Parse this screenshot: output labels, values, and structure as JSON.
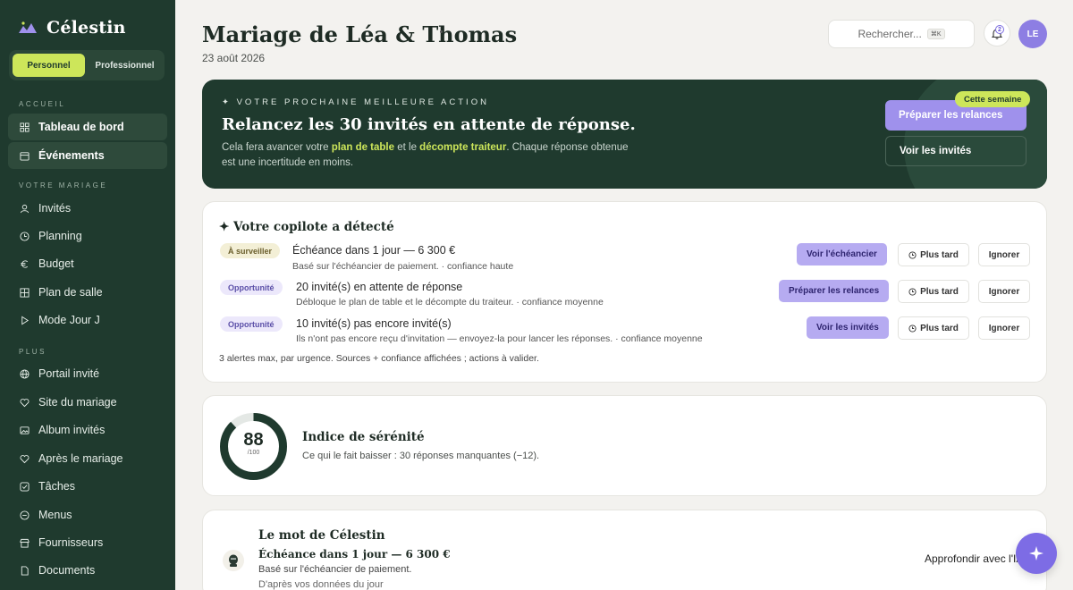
{
  "app": {
    "name": "Célestin"
  },
  "mode_switch": {
    "options": [
      "Personnel",
      "Professionnel"
    ],
    "active": "Personnel"
  },
  "sidebar": {
    "section_home": "ACCUEIL",
    "home_items": [
      {
        "label": "Tableau de bord",
        "icon": "dashboard-icon"
      },
      {
        "label": "Événements",
        "icon": "calendar-icon"
      }
    ],
    "section_wedding": "VOTRE MARIAGE",
    "wedding_items": [
      {
        "label": "Invités",
        "icon": "users-icon"
      },
      {
        "label": "Planning",
        "icon": "clock-icon"
      },
      {
        "label": "Budget",
        "icon": "euro-icon"
      },
      {
        "label": "Plan de salle",
        "icon": "grid-icon"
      },
      {
        "label": "Mode Jour J",
        "icon": "play-icon"
      }
    ],
    "section_more": "PLUS",
    "more_items": [
      {
        "label": "Portail invité",
        "icon": "globe-icon"
      },
      {
        "label": "Site du mariage",
        "icon": "heart-icon"
      },
      {
        "label": "Album invités",
        "icon": "image-icon"
      },
      {
        "label": "Après le mariage",
        "icon": "heart-icon"
      },
      {
        "label": "Tâches",
        "icon": "check-icon"
      },
      {
        "label": "Menus",
        "icon": "menu-icon"
      },
      {
        "label": "Fournisseurs",
        "icon": "store-icon"
      },
      {
        "label": "Documents",
        "icon": "document-icon"
      }
    ]
  },
  "header": {
    "title": "Mariage de Léa & Thomas",
    "date": "23 août 2026",
    "search_placeholder": "Rechercher...",
    "search_shortcut": "⌘K",
    "notification_count": "2",
    "avatar_initials": "LE"
  },
  "hero": {
    "eyebrow": "✦ Votre prochaine meilleure action",
    "title": "Relancez les 30 invités en attente de réponse.",
    "text_before": "Cela fera avancer votre ",
    "text_em1": "plan de table",
    "text_mid": " et le ",
    "text_em2": "décompte traiteur",
    "text_after": ". Chaque réponse obtenue est une incertitude en moins.",
    "badge": "Cette semaine",
    "primary_button": "Préparer les relances",
    "secondary_button": "Voir les invités"
  },
  "copilot": {
    "title": "✦ Votre copilote a détecté",
    "alerts": [
      {
        "badge": "À surveiller",
        "badge_type": "watch",
        "title": "Échéance dans 1 jour — 6 300 €",
        "subtitle": "Basé sur l'échéancier de paiement. · confiance haute",
        "action": "Voir l'échéancier",
        "later": "Plus tard",
        "ignore": "Ignorer"
      },
      {
        "badge": "Opportunité",
        "badge_type": "opportunity",
        "title": "20 invité(s) en attente de réponse",
        "subtitle": "Débloque le plan de table et le décompte du traiteur. · confiance moyenne",
        "action": "Préparer les relances",
        "later": "Plus tard",
        "ignore": "Ignorer"
      },
      {
        "badge": "Opportunité",
        "badge_type": "opportunity",
        "title": "10 invité(s) pas encore invité(s)",
        "subtitle": "Ils n'ont pas encore reçu d'invitation — envoyez-la pour lancer les réponses. · confiance moyenne",
        "action": "Voir les invités",
        "later": "Plus tard",
        "ignore": "Ignorer"
      }
    ],
    "footer": "3 alertes max, par urgence. Sources + confiance affichées ; actions à valider."
  },
  "serenity": {
    "score": 88,
    "score_max": "/100",
    "title": "Indice de sérénité",
    "subtitle": "Ce qui le fait baisser : 30 réponses manquantes (−12).",
    "colors": {
      "ring": "#1f3a2e",
      "track": "#e4e8e5"
    }
  },
  "word": {
    "title": "Le mot de Célestin",
    "line1": "Échéance dans 1 jour — 6 300 €",
    "line2": "Basé sur l'échéancier de paiement.",
    "line3": "D'après vos données du jour",
    "button": "Approfondir avec l'IA"
  },
  "colors": {
    "sidebar": "#1f3a2e",
    "accent_lime": "#cde65a",
    "accent_purple": "#9f91ec"
  }
}
